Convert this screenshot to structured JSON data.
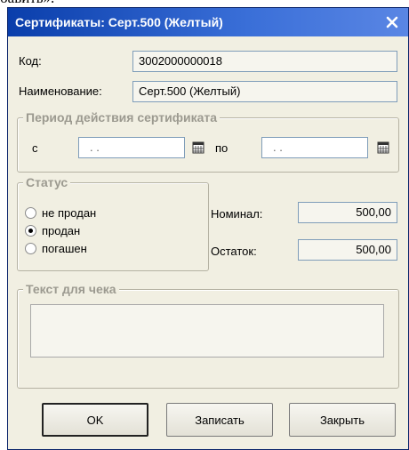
{
  "top_text": "бавить».",
  "window": {
    "title": "Сертификаты: Серт.500 (Желтый)",
    "close_icon": "close-icon"
  },
  "fields": {
    "code_label": "Код:",
    "code_value": "3002000000018",
    "name_label": "Наименование:",
    "name_value": "Серт.500 (Желтый)"
  },
  "period": {
    "legend": "Период действия сертификата",
    "from_label": "с",
    "from_value": ". .",
    "to_label": "по",
    "to_value": ". ."
  },
  "status": {
    "legend": "Статус",
    "options": [
      "не продан",
      "продан",
      "погашен"
    ],
    "selected": 1
  },
  "amounts": {
    "nominal_label": "Номинал:",
    "nominal_value": "500,00",
    "remainder_label": "Остаток:",
    "remainder_value": "500,00"
  },
  "receipt": {
    "legend": "Текст для чека",
    "value": ""
  },
  "buttons": {
    "ok": "OK",
    "save": "Записать",
    "close": "Закрыть"
  }
}
